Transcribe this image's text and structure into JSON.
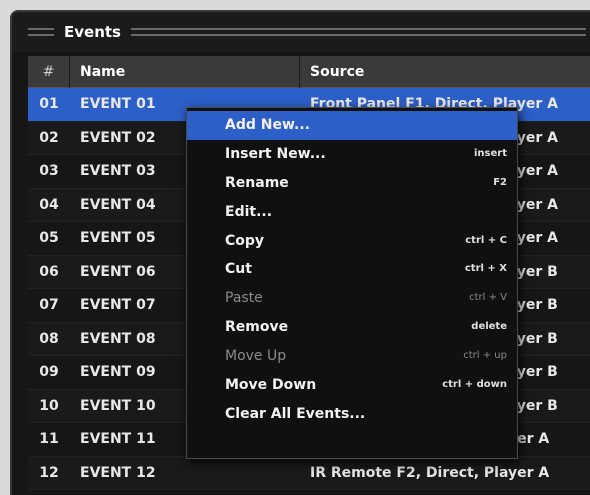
{
  "panel": {
    "title": "Events"
  },
  "table": {
    "headers": {
      "num": "#",
      "name": "Name",
      "source": "Source"
    },
    "rows": [
      {
        "num": "01",
        "name": "EVENT 01",
        "source": "Front Panel F1, Direct, Player A"
      },
      {
        "num": "02",
        "name": "EVENT 02",
        "source": "Front Panel F2, Direct, Player A"
      },
      {
        "num": "03",
        "name": "EVENT 03",
        "source": "Front Panel F3, Direct, Player A"
      },
      {
        "num": "04",
        "name": "EVENT 04",
        "source": "Front Panel F4, Direct, Player A"
      },
      {
        "num": "05",
        "name": "EVENT 05",
        "source": "Front Panel F5, Direct, Player A"
      },
      {
        "num": "06",
        "name": "EVENT 06",
        "source": "Front Panel F1, Direct, Player B"
      },
      {
        "num": "07",
        "name": "EVENT 07",
        "source": "Front Panel F2, Direct, Player B"
      },
      {
        "num": "08",
        "name": "EVENT 08",
        "source": "Front Panel F3, Direct, Player B"
      },
      {
        "num": "09",
        "name": "EVENT 09",
        "source": "Front Panel F4, Direct, Player B"
      },
      {
        "num": "10",
        "name": "EVENT 10",
        "source": "Front Panel F5, Direct, Player B"
      },
      {
        "num": "11",
        "name": "EVENT 11",
        "source": "IR Remote F1, Direct, Player A"
      },
      {
        "num": "12",
        "name": "EVENT 12",
        "source": "IR Remote F2, Direct, Player A"
      }
    ],
    "selected_row": "01"
  },
  "context_menu": {
    "items": [
      {
        "label": "Add New...",
        "shortcut": ""
      },
      {
        "label": "Insert New...",
        "shortcut": "insert"
      },
      {
        "label": "Rename",
        "shortcut": "F2"
      },
      {
        "label": "Edit...",
        "shortcut": ""
      },
      {
        "label": "Copy",
        "shortcut": "ctrl + C"
      },
      {
        "label": "Cut",
        "shortcut": "ctrl + X"
      },
      {
        "label": "Paste",
        "shortcut": "ctrl + V"
      },
      {
        "label": "Remove",
        "shortcut": "delete"
      },
      {
        "label": "Move Up",
        "shortcut": "ctrl + up"
      },
      {
        "label": "Move Down",
        "shortcut": "ctrl + down"
      },
      {
        "label": "Clear All Events...",
        "shortcut": ""
      }
    ]
  },
  "colors": {
    "selection": "#2d5fc8",
    "background": "#161616",
    "header": "#3a3a3a"
  }
}
